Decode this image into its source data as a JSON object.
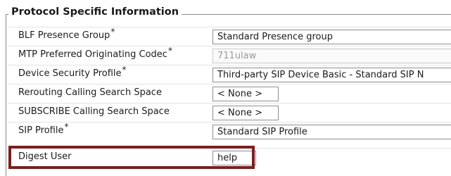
{
  "section": {
    "title": "Protocol Specific Information"
  },
  "fields": [
    {
      "label": "BLF Presence Group",
      "required": "*",
      "value": "Standard Presence group"
    },
    {
      "label": "MTP Preferred Originating Codec",
      "required": "*",
      "value": "711ulaw"
    },
    {
      "label": "Device Security Profile",
      "required": "*",
      "value": "Third-party SIP Device Basic - Standard SIP N"
    },
    {
      "label": "Rerouting Calling Search Space",
      "required": "",
      "value": "< None >"
    },
    {
      "label": "SUBSCRIBE Calling Search Space",
      "required": "",
      "value": "< None >"
    },
    {
      "label": "SIP Profile",
      "required": "*",
      "value": "Standard SIP Profile"
    },
    {
      "label": "Digest User",
      "required": "",
      "value": "help"
    }
  ],
  "colors": {
    "highlight_border": "#7a1f21"
  }
}
